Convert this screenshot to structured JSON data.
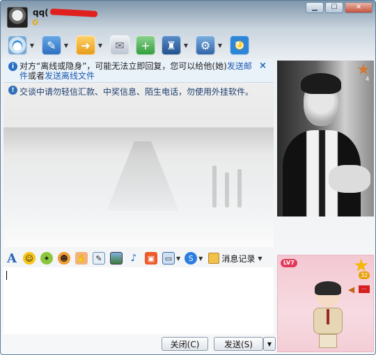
{
  "title": {
    "contact_name": "qq(",
    "window_controls": [
      "minimize",
      "maximize",
      "close"
    ]
  },
  "toolbar": {
    "items": [
      {
        "icon": "webcam-icon",
        "has_dropdown": true
      },
      {
        "icon": "microphone-icon",
        "has_dropdown": true
      },
      {
        "icon": "send-file-icon",
        "has_dropdown": true
      },
      {
        "icon": "message-icon",
        "has_dropdown": false
      },
      {
        "icon": "add-app-icon",
        "has_dropdown": false
      },
      {
        "icon": "group-icon",
        "has_dropdown": true
      },
      {
        "icon": "settings-icon",
        "has_dropdown": true
      },
      {
        "icon": "share-icon",
        "has_dropdown": false
      }
    ]
  },
  "notice": {
    "text_before": "对方“离线或隐身”，可能无法立即回复，您可以给他(她)",
    "link1": "发送邮件",
    "text_middle": "或者",
    "link2": "发送离线文件",
    "close_symbol": "×"
  },
  "safety_notice": {
    "text": "交谈中请勿轻信汇款、中奖信息、陌生电话，勿使用外挂软件。"
  },
  "input_toolbar": {
    "font_label": "A",
    "history_label": "消息记录"
  },
  "buttons": {
    "close_label": "关闭(C)",
    "send_label": "发送(S)"
  },
  "photo": {
    "star_count": "4"
  },
  "show_panel": {
    "level_badge": "LV7",
    "star_count": "32"
  },
  "colors": {
    "accent": "#1c5ab0",
    "notice_bg": "#e9f1f9",
    "show_bg": "#f7dbe2"
  }
}
